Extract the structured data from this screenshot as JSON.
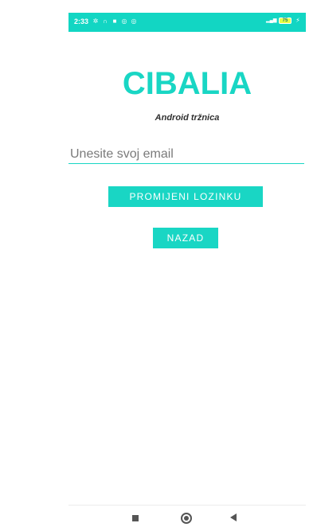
{
  "status_bar": {
    "time": "2:33",
    "icons": [
      "settings-icon",
      "headphones-icon",
      "app-icon",
      "sync-icon",
      "sync-icon"
    ],
    "battery": "75",
    "signal": "4G"
  },
  "colors": {
    "accent": "#19d6c4",
    "status_bar": "#12d6c3"
  },
  "app": {
    "title": "CIBALIA",
    "subtitle": "Android tržnica"
  },
  "form": {
    "email_placeholder": "Unesite svoj email",
    "email_value": ""
  },
  "buttons": {
    "change_password": "PROMIJENI LOZINKU",
    "back": "NAZAD"
  },
  "nav": {
    "icons": [
      "recent-apps-icon",
      "home-icon",
      "back-icon"
    ]
  }
}
